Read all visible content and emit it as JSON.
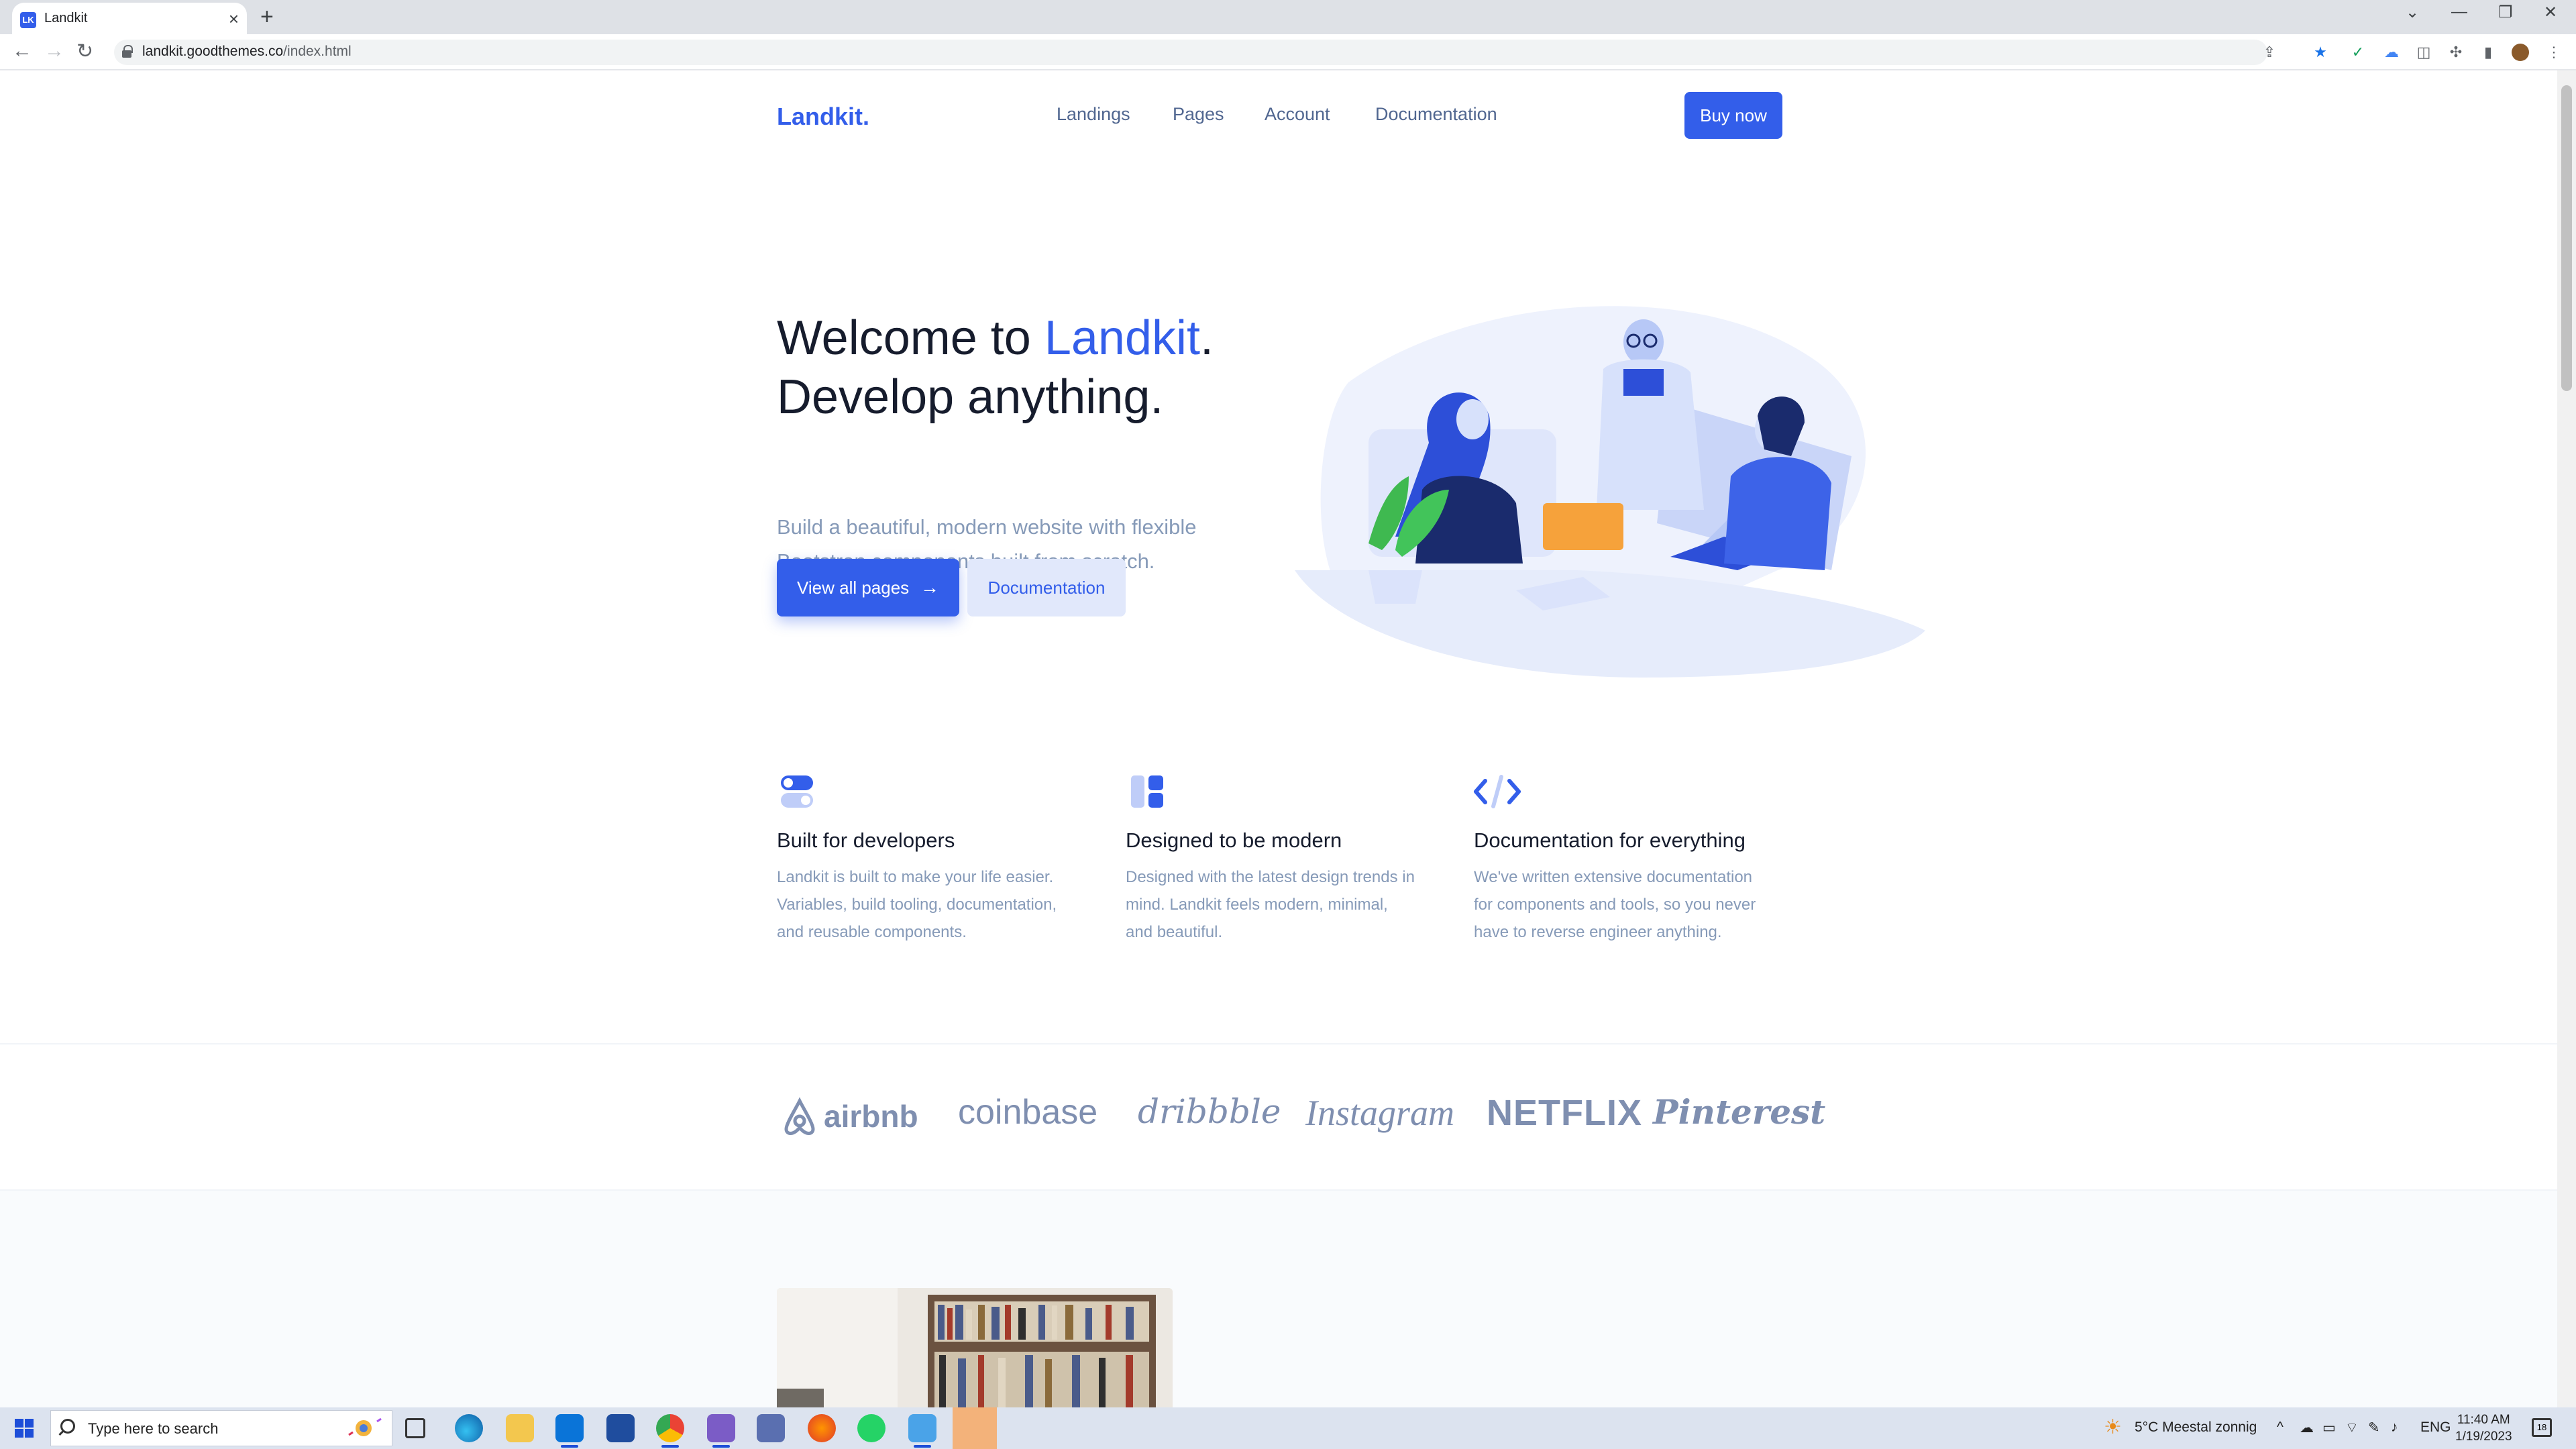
{
  "browser": {
    "tab_title": "Landkit",
    "favicon_text": "LK",
    "url_host": "landkit.goodthemes.co",
    "url_path": "/index.html"
  },
  "nav": {
    "brand": "Landkit.",
    "links": [
      "Landings",
      "Pages",
      "Account",
      "Documentation"
    ],
    "buy_label": "Buy now"
  },
  "hero": {
    "title_prefix": "Welcome to ",
    "title_accent": "Landkit",
    "title_period": ".",
    "title_line2": "Develop anything.",
    "lead_line1": "Build a beautiful, modern website with flexible",
    "lead_line2": "Bootstrap components built from scratch.",
    "primary_button": "View all pages",
    "secondary_button": "Documentation"
  },
  "features": [
    {
      "title": "Built for developers",
      "lines": [
        "Landkit is built to make your life easier.",
        "Variables, build tooling, documentation,",
        "and reusable components."
      ]
    },
    {
      "title": "Designed to be modern",
      "lines": [
        "Designed with the latest design trends in",
        "mind. Landkit feels modern, minimal,",
        "and beautiful."
      ]
    },
    {
      "title": "Documentation for everything",
      "lines": [
        "We've written extensive documentation",
        "for components and tools, so you never",
        "have to reverse engineer anything."
      ]
    }
  ],
  "logos": [
    "airbnb",
    "coinbase",
    "dribbble",
    "Instagram",
    "NETFLIX",
    "Pinterest"
  ],
  "taskbar": {
    "search_placeholder": "Type here to search",
    "weather": "5°C  Meestal zonnig",
    "language": "ENG",
    "time": "11:40 AM",
    "date": "1/19/2023",
    "notification_count": "18"
  },
  "colors": {
    "primary": "#335eea",
    "heading": "#161c2d",
    "muted": "#869ab8",
    "nav": "#506690"
  }
}
